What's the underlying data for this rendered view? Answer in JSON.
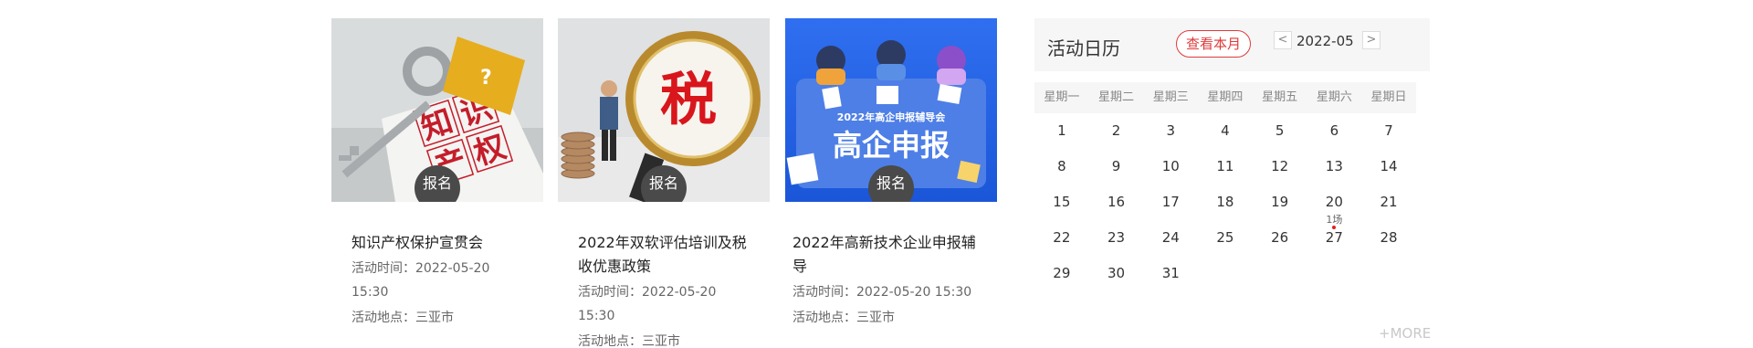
{
  "cards": [
    {
      "image": "ip-keys-image",
      "image_text": [
        "知",
        "识",
        "产",
        "权"
      ],
      "signup_label": "报名",
      "title": "知识产权保护宣贯会",
      "time_label": "活动时间：",
      "time": "2022-05-20 15:30",
      "location_label": "活动地点：",
      "location": "三亚市"
    },
    {
      "image": "tax-magnifier-image",
      "image_text": [
        "税"
      ],
      "signup_label": "报名",
      "title_line1": "2022年双软评估培训及税",
      "title_line2": "收优惠政策",
      "time_label": "活动时间：",
      "time": "2022-05-20 15:30",
      "location_label": "活动地点：",
      "location": "三亚市"
    },
    {
      "image": "high-tech-meeting-image",
      "image_text": [
        "2022年高企申报辅导会",
        "高企申报"
      ],
      "signup_label": "报名",
      "title": "2022年高新技术企业申报辅导",
      "time_label": "活动时间：",
      "time": "2022-05-20 15:30",
      "location_label": "活动地点：",
      "location": "三亚市"
    }
  ],
  "calendar": {
    "title": "活动日历",
    "this_month_button": "查看本月",
    "prev_icon": "chevron-left-icon",
    "prev_glyph": "<",
    "next_icon": "chevron-right-icon",
    "next_glyph": ">",
    "month": "2022-05",
    "weekdays": [
      "星期一",
      "星期二",
      "星期三",
      "星期四",
      "星期五",
      "星期六",
      "星期日"
    ],
    "weeks": [
      [
        "1",
        "2",
        "3",
        "4",
        "5",
        "6",
        "7"
      ],
      [
        "8",
        "9",
        "10",
        "11",
        "12",
        "13",
        "14"
      ],
      [
        "15",
        "16",
        "17",
        "18",
        "19",
        "20",
        "21"
      ],
      [
        "22",
        "23",
        "24",
        "25",
        "26",
        "27",
        "28"
      ],
      [
        "29",
        "30",
        "31",
        "",
        "",
        "",
        ""
      ]
    ],
    "events": [
      {
        "day": "20",
        "count_label": "1场",
        "dot_color": "#e02020"
      }
    ],
    "more_label": "+MORE"
  },
  "colors": {
    "accent": "#e03a3a",
    "signup_button": "#4a4a4a",
    "header_bg": "#f6f6f6"
  }
}
